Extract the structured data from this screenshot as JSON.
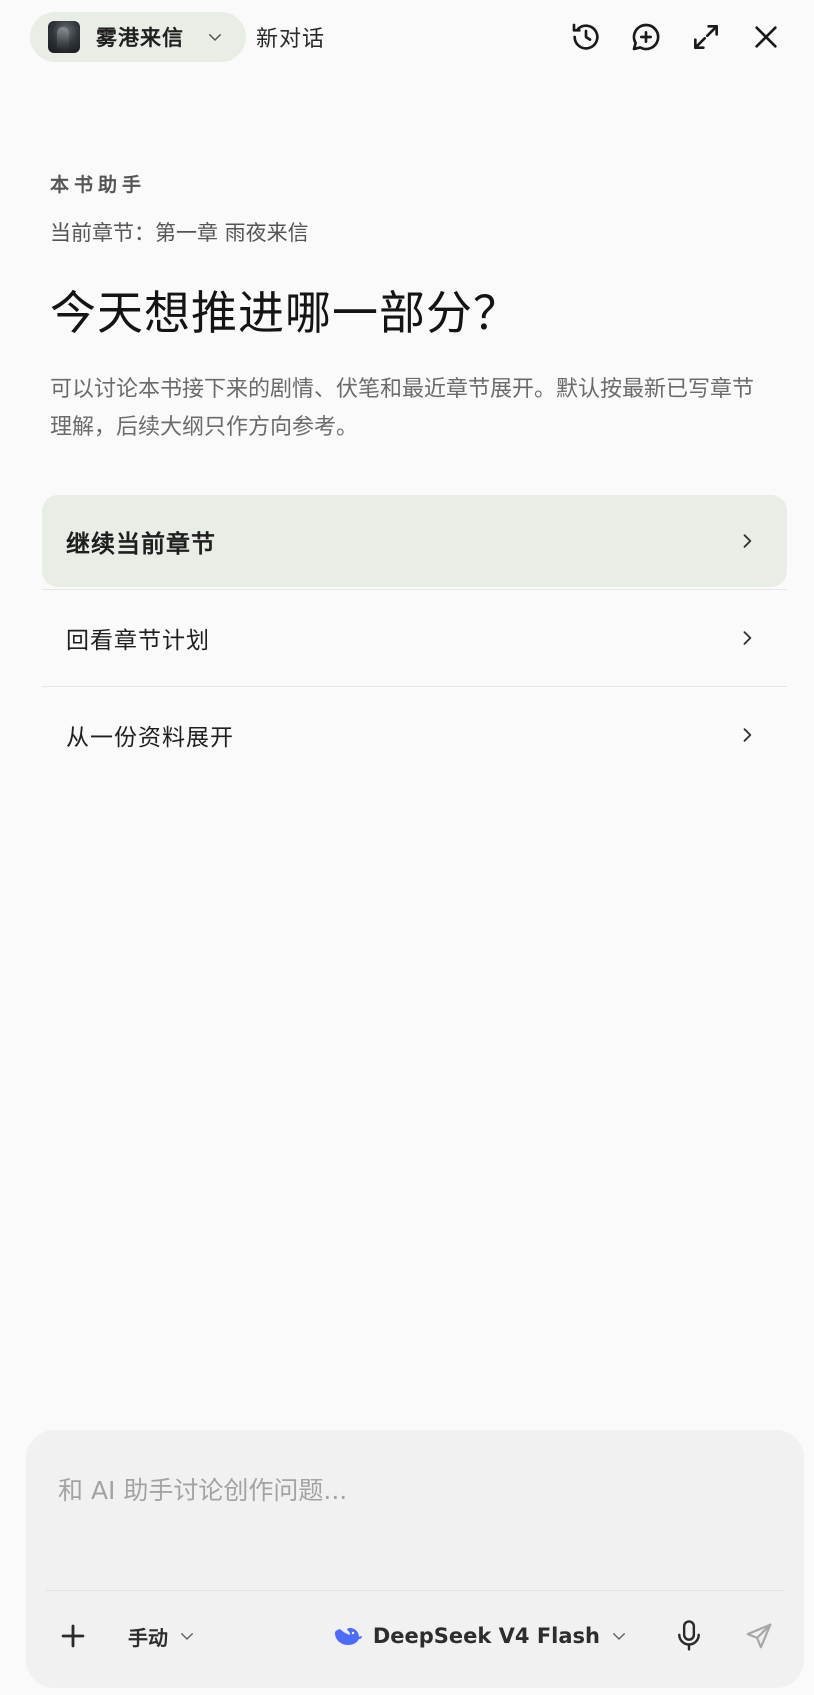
{
  "header": {
    "book_title": "雾港来信",
    "new_chat_label": "新对话",
    "icons": [
      "book-cover-icon",
      "chevron-down-icon",
      "history-icon",
      "new-chat-icon",
      "expand-icon",
      "close-icon"
    ]
  },
  "intro": {
    "label": "本书助手",
    "chapter": "当前章节：第一章 雨夜来信",
    "headline": "今天想推进哪一部分？",
    "description": "可以讨论本书接下来的剧情、伏笔和最近章节展开。默认按最新已写章节理解，后续大纲只作方向参考。"
  },
  "options": [
    {
      "label": "继续当前章节",
      "active": true
    },
    {
      "label": "回看章节计划",
      "active": false
    },
    {
      "label": "从一份资料展开",
      "active": false
    }
  ],
  "composer": {
    "placeholder": "和 AI 助手讨论创作问题...",
    "mode_label": "手动",
    "model_label": "DeepSeek V4 Flash"
  },
  "colors": {
    "background": "#fafafa",
    "accent_green": "#e8eee6",
    "model_blue": "#4d6bfe"
  }
}
